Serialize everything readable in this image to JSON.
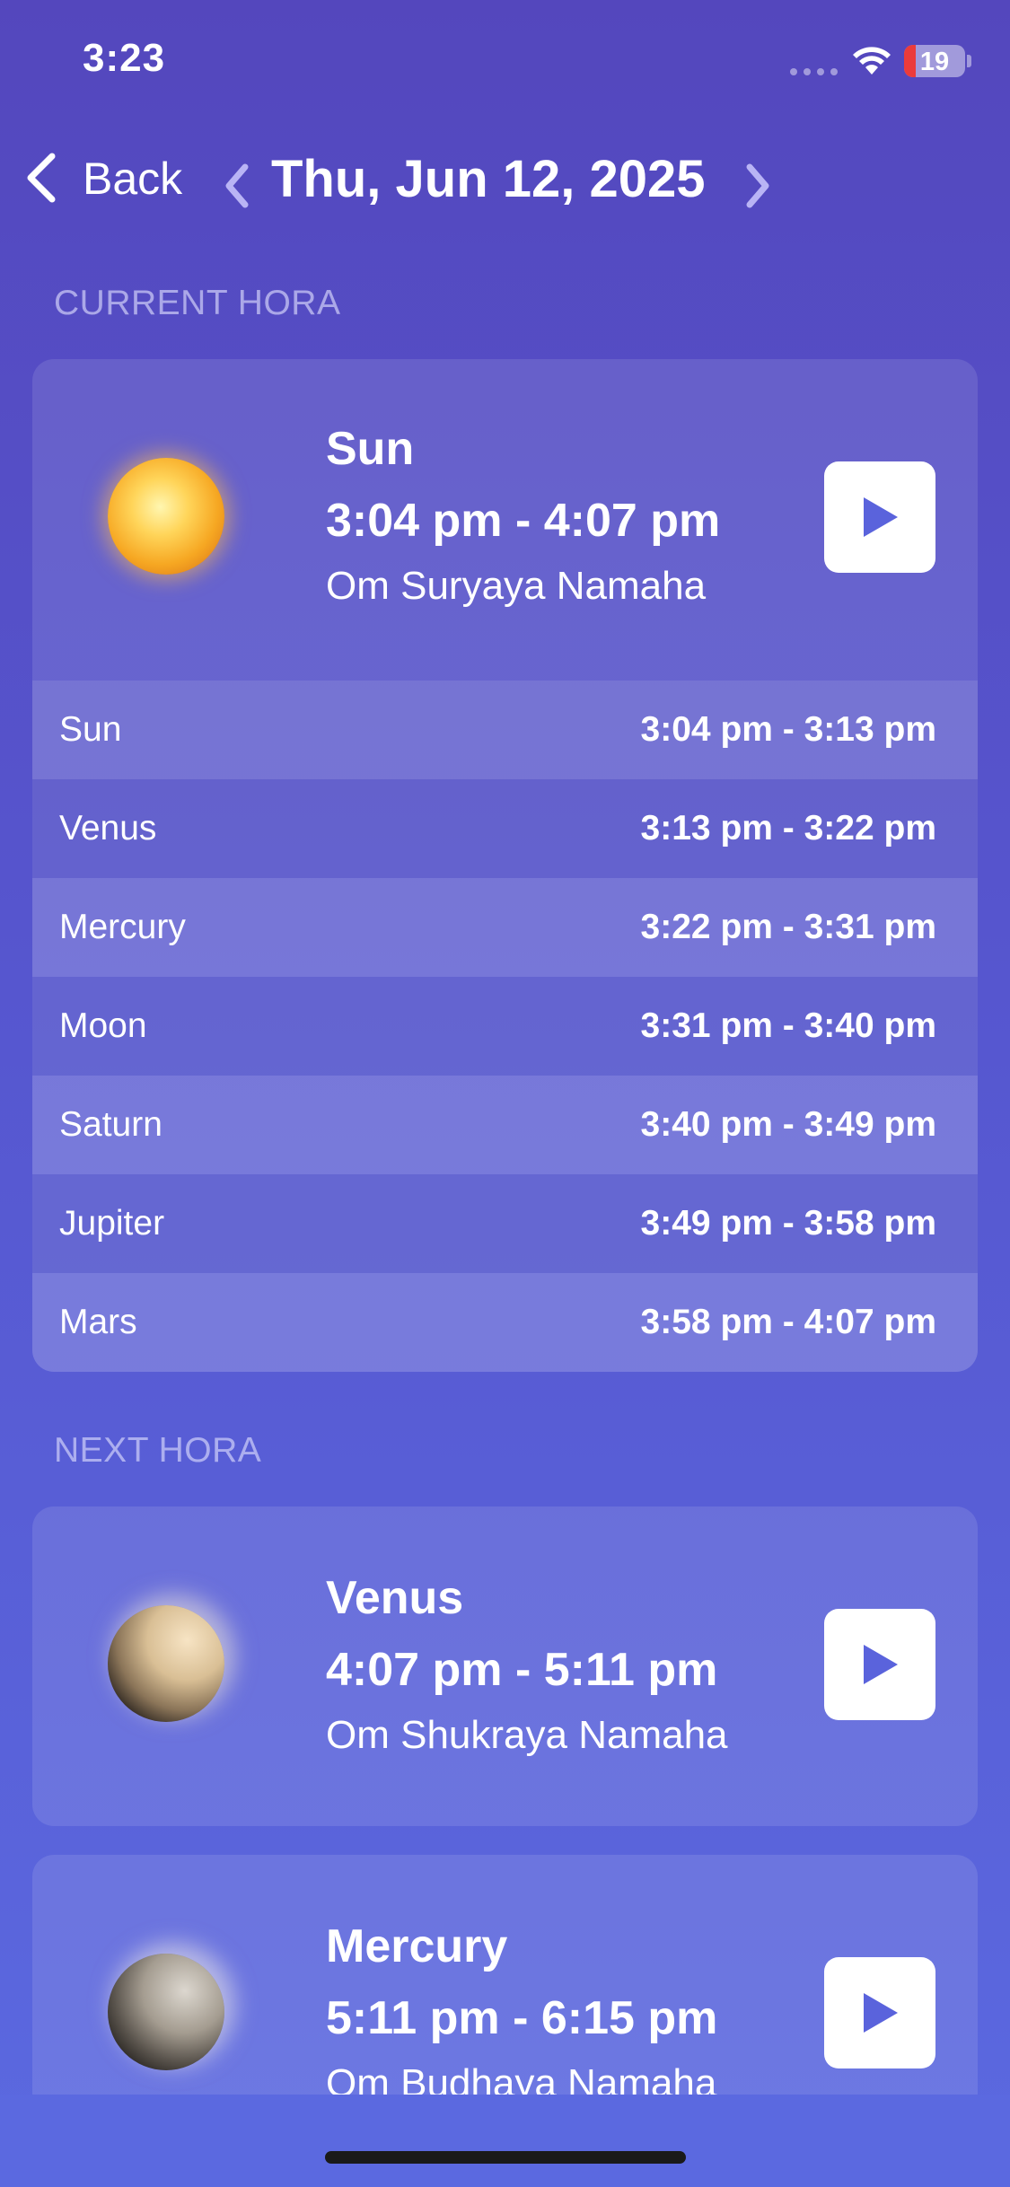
{
  "status_bar": {
    "time": "3:23",
    "battery": "19",
    "battery_level": 0.19
  },
  "nav": {
    "back_label": "Back",
    "date": "Thu, Jun 12, 2025"
  },
  "current_hora": {
    "section_label": "CURRENT HORA",
    "planet": "Sun",
    "time_range": "3:04 pm - 4:07 pm",
    "mantra": "Om Suryaya Namaha",
    "sub_horas": [
      {
        "planet": "Sun",
        "time": "3:04 pm - 3:13 pm"
      },
      {
        "planet": "Venus",
        "time": "3:13 pm - 3:22 pm"
      },
      {
        "planet": "Mercury",
        "time": "3:22 pm - 3:31 pm"
      },
      {
        "planet": "Moon",
        "time": "3:31 pm - 3:40 pm"
      },
      {
        "planet": "Saturn",
        "time": "3:40 pm - 3:49 pm"
      },
      {
        "planet": "Jupiter",
        "time": "3:49 pm - 3:58 pm"
      },
      {
        "planet": "Mars",
        "time": "3:58 pm - 4:07 pm"
      }
    ]
  },
  "next_hora": {
    "section_label": "NEXT HORA",
    "items": [
      {
        "planet": "Venus",
        "time_range": "4:07 pm - 5:11 pm",
        "mantra": "Om Shukraya Namaha"
      },
      {
        "planet": "Mercury",
        "time_range": "5:11 pm - 6:15 pm",
        "mantra": "Om Budhaya Namaha"
      }
    ]
  },
  "colors": {
    "accent": "#5a63dc",
    "background_top": "#5447bd",
    "background_bottom": "#5b69e0"
  },
  "icons": [
    "back-chevron-icon",
    "chevron-left-icon",
    "chevron-right-icon",
    "play-icon",
    "wifi-icon",
    "battery-icon"
  ]
}
